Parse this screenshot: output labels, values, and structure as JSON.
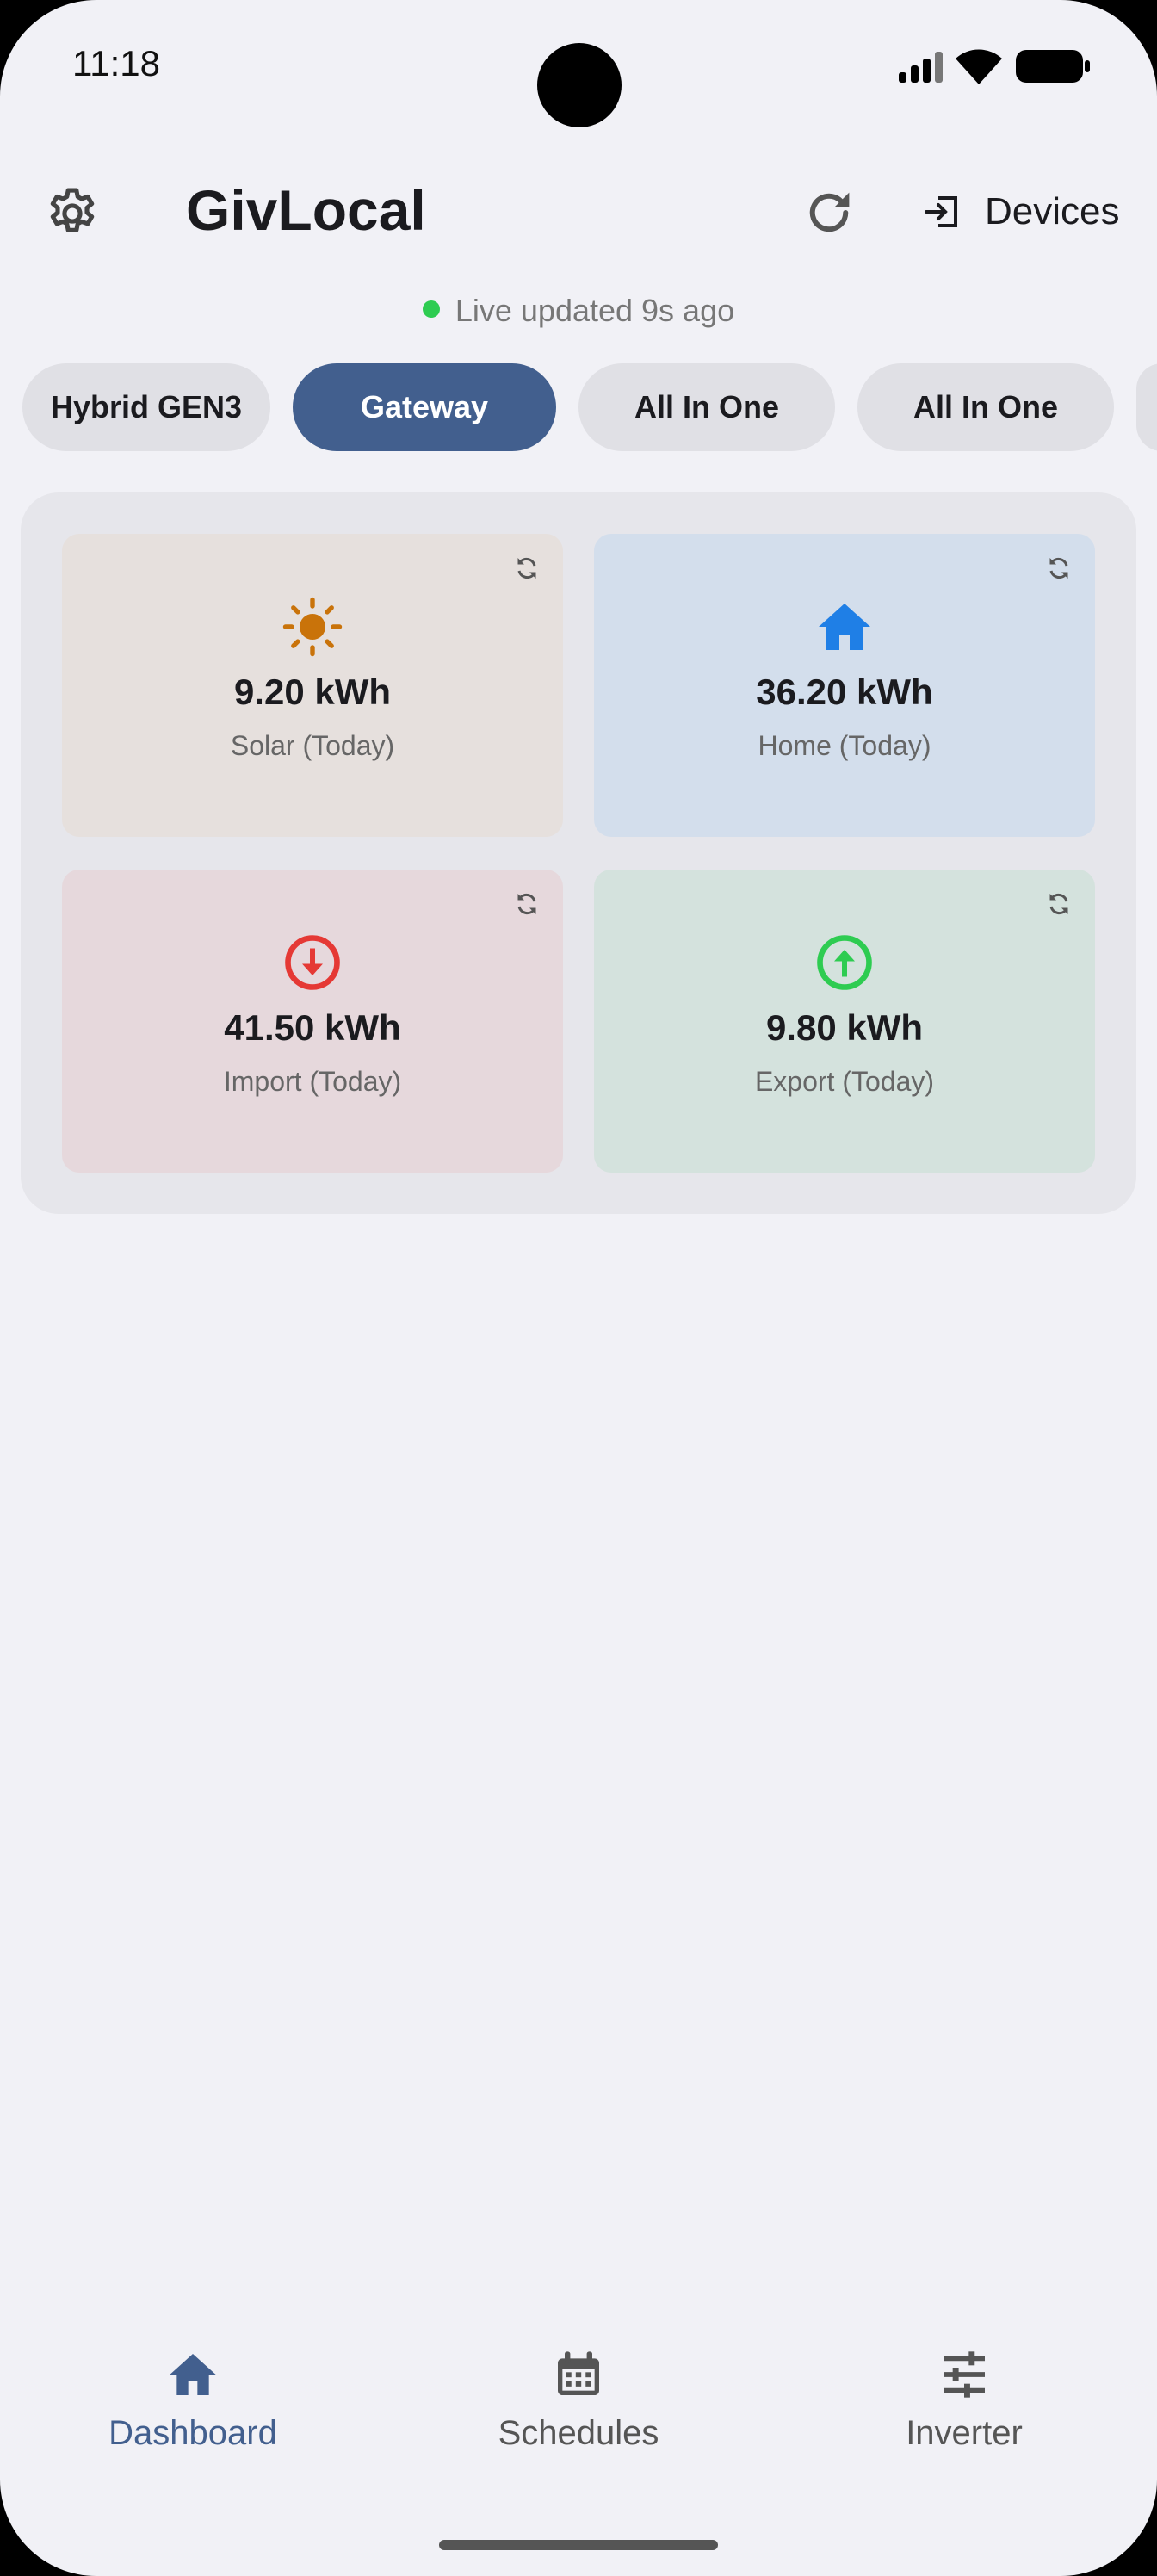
{
  "status": {
    "time": "11:18"
  },
  "appbar": {
    "title": "GivLocal",
    "devices_label": "Devices",
    "live_text": "Live updated 9s ago"
  },
  "chips": [
    {
      "label": "Hybrid GEN3",
      "active": false
    },
    {
      "label": "Gateway",
      "active": true
    },
    {
      "label": "All In One",
      "active": false
    },
    {
      "label": "All In One",
      "active": false
    }
  ],
  "stats": {
    "solar": {
      "value": "9.20 kWh",
      "label": "Solar (Today)",
      "icon": "sun-icon",
      "color": "#c9730a"
    },
    "home": {
      "value": "36.20 kWh",
      "label": "Home (Today)",
      "icon": "home-icon",
      "color": "#1f7fe6"
    },
    "import": {
      "value": "41.50 kWh",
      "label": "Import (Today)",
      "icon": "arrow-down-circle-icon",
      "color": "#e53935"
    },
    "export": {
      "value": "9.80 kWh",
      "label": "Export (Today)",
      "icon": "arrow-up-circle-icon",
      "color": "#2ecc51"
    }
  },
  "nav": [
    {
      "label": "Dashboard",
      "icon": "home-icon",
      "active": true
    },
    {
      "label": "Schedules",
      "icon": "calendar-icon",
      "active": false
    },
    {
      "label": "Inverter",
      "icon": "sliders-icon",
      "active": false
    }
  ],
  "colors": {
    "accent": "#425f8e",
    "background": "#f1f1f6"
  }
}
